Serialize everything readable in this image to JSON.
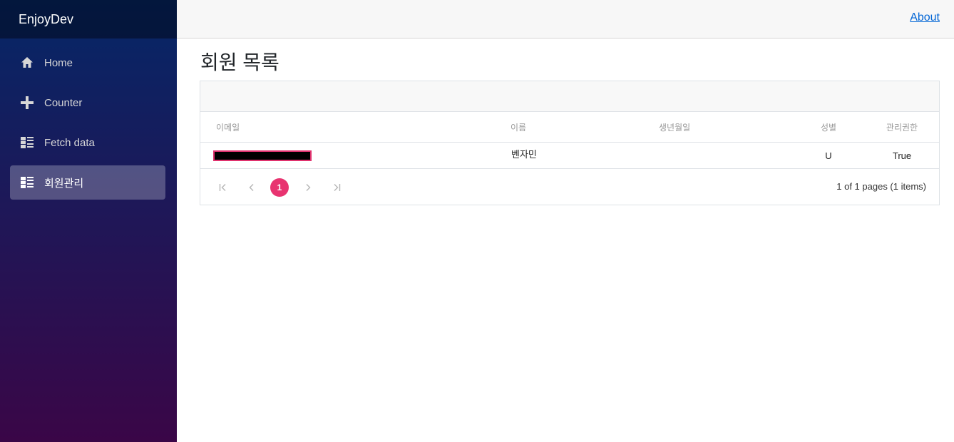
{
  "sidebar": {
    "brand": "EnjoyDev",
    "items": [
      {
        "label": "Home",
        "icon": "home-icon"
      },
      {
        "label": "Counter",
        "icon": "plus-icon"
      },
      {
        "label": "Fetch data",
        "icon": "list-icon"
      },
      {
        "label": "회원관리",
        "icon": "list-icon",
        "active": true
      }
    ],
    "gradient_top": "#052767",
    "gradient_bottom": "#3a0647"
  },
  "topbar": {
    "about_label": "About"
  },
  "main": {
    "title": "회원 목록",
    "grid": {
      "columns": [
        "이메일",
        "이름",
        "생년월일",
        "성별",
        "관리권한"
      ],
      "rows": [
        {
          "email": "",
          "name": "벤자민",
          "birth": "",
          "gender": "U",
          "admin": "True"
        }
      ],
      "pager": {
        "current_page": "1",
        "summary": "1 of 1 pages (1 items)",
        "accent": "#e83370"
      }
    }
  }
}
